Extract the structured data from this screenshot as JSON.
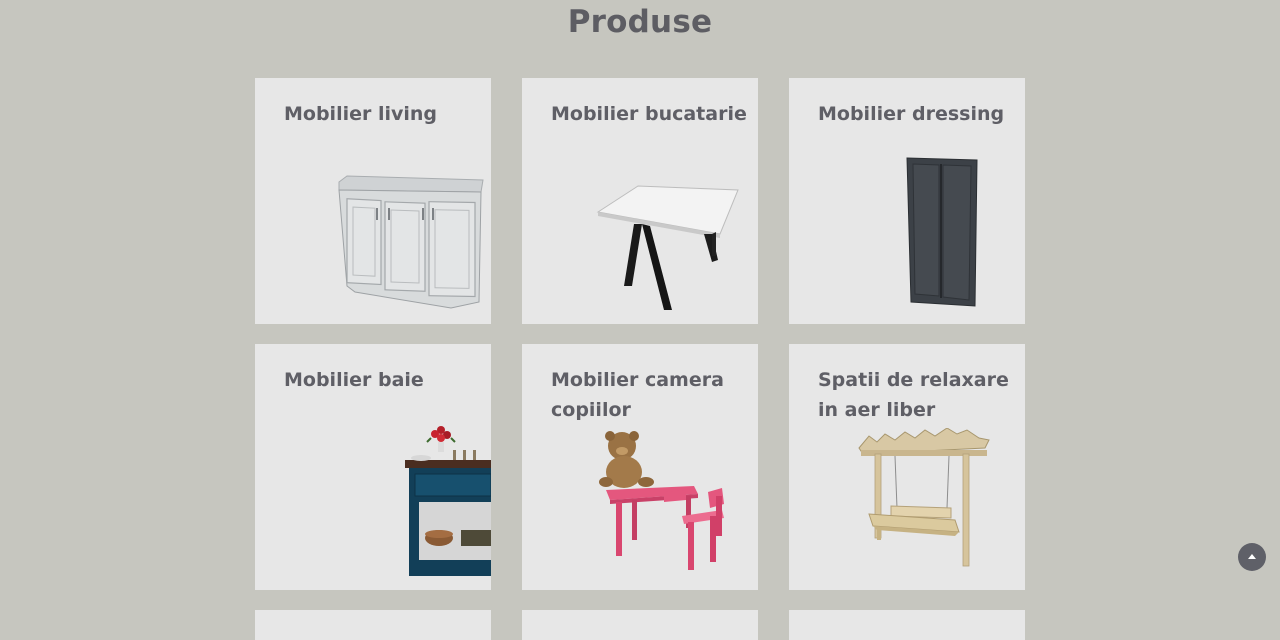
{
  "page": {
    "title": "Produse"
  },
  "products": [
    {
      "title": "Mobilier living",
      "image": "cabinet-image"
    },
    {
      "title": "Mobilier bucatarie",
      "image": "table-image"
    },
    {
      "title": "Mobilier dressing",
      "image": "wardrobe-image"
    },
    {
      "title": "Mobilier baie",
      "image": "bathroom-vanity-image"
    },
    {
      "title": "Mobilier camera copiilor",
      "image": "kids-table-chair-image"
    },
    {
      "title": "Spatii de relaxare in aer liber",
      "image": "pergola-swing-image"
    }
  ],
  "scroll_top": {
    "icon": "chevron-up-icon"
  },
  "colors": {
    "background": "#c6c6bf",
    "card": "#e7e7e7",
    "text": "#5f5f66"
  }
}
